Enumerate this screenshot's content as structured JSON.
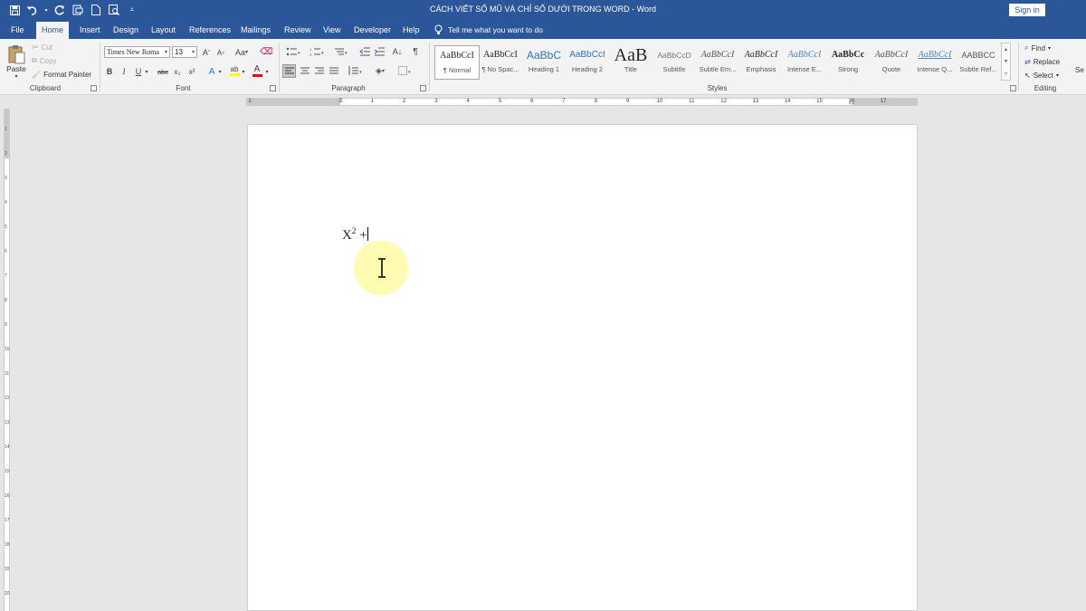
{
  "window": {
    "title": "CÁCH VIẾT SỐ MŨ VÀ CHỈ SỐ DƯỚI TRONG WORD  -  Word",
    "signin_label": "Sign in"
  },
  "tabs": [
    {
      "label": "File"
    },
    {
      "label": "Home"
    },
    {
      "label": "Insert"
    },
    {
      "label": "Design"
    },
    {
      "label": "Layout"
    },
    {
      "label": "References"
    },
    {
      "label": "Mailings"
    },
    {
      "label": "Review"
    },
    {
      "label": "View"
    },
    {
      "label": "Developer"
    },
    {
      "label": "Help"
    }
  ],
  "active_tab": "Home",
  "tell_me": "Tell me what you want to do",
  "clipboard": {
    "paste": "Paste",
    "cut": "Cut",
    "copy": "Copy",
    "format_painter": "Format Painter",
    "group_label": "Clipboard"
  },
  "font": {
    "name": "Times New Roma",
    "size": "13",
    "group_label": "Font",
    "bold": "B",
    "italic": "I",
    "underline": "U",
    "strike": "abc",
    "subscript": "x₂",
    "superscript": "x²",
    "case": "Aa"
  },
  "paragraph": {
    "group_label": "Paragraph",
    "pilcrow": "¶"
  },
  "styles": {
    "group_label": "Styles",
    "items": [
      {
        "preview": "AaBbCcI",
        "name": "¶ Normal"
      },
      {
        "preview": "AaBbCcI",
        "name": "¶ No Spac..."
      },
      {
        "preview": "AaBbC",
        "name": "Heading 1"
      },
      {
        "preview": "AaBbCcI",
        "name": "Heading 2"
      },
      {
        "preview": "AaB",
        "name": "Title"
      },
      {
        "preview": "AaBbCcD",
        "name": "Subtitle"
      },
      {
        "preview": "AaBbCcI",
        "name": "Subtle Em..."
      },
      {
        "preview": "AaBbCcI",
        "name": "Emphasis"
      },
      {
        "preview": "AaBbCcI",
        "name": "Intense E..."
      },
      {
        "preview": "AaBbCc",
        "name": "Strong"
      },
      {
        "preview": "AaBbCcI",
        "name": "Quote"
      },
      {
        "preview": "AaBbCcI",
        "name": "Intense Q..."
      },
      {
        "preview": "AABBCC",
        "name": "Subtle Ref..."
      }
    ]
  },
  "editing": {
    "find": "Find",
    "replace": "Replace",
    "select": "Select",
    "group_label": "Editing",
    "overflow": "Se"
  },
  "ruler": {
    "numbers": [
      "1",
      "1",
      "2",
      "3",
      "4",
      "5",
      "6",
      "7",
      "8",
      "9",
      "10",
      "11",
      "12",
      "13",
      "14",
      "15",
      "16",
      "17"
    ]
  },
  "vruler": {
    "numbers": [
      "1",
      "2",
      "3",
      "4",
      "5",
      "6",
      "7",
      "8",
      "9",
      "10",
      "11",
      "12",
      "13",
      "14",
      "15",
      "16",
      "17",
      "18",
      "19",
      "20"
    ]
  },
  "document": {
    "base": "X",
    "superscript": "2",
    "rest": " +"
  },
  "colors": {
    "titlebar": "#2b579a",
    "ribbon": "#f3f3f3",
    "highlight": "#fffa96",
    "font_color_red": "#ff0000",
    "highlighter_yellow": "#ffff00"
  }
}
